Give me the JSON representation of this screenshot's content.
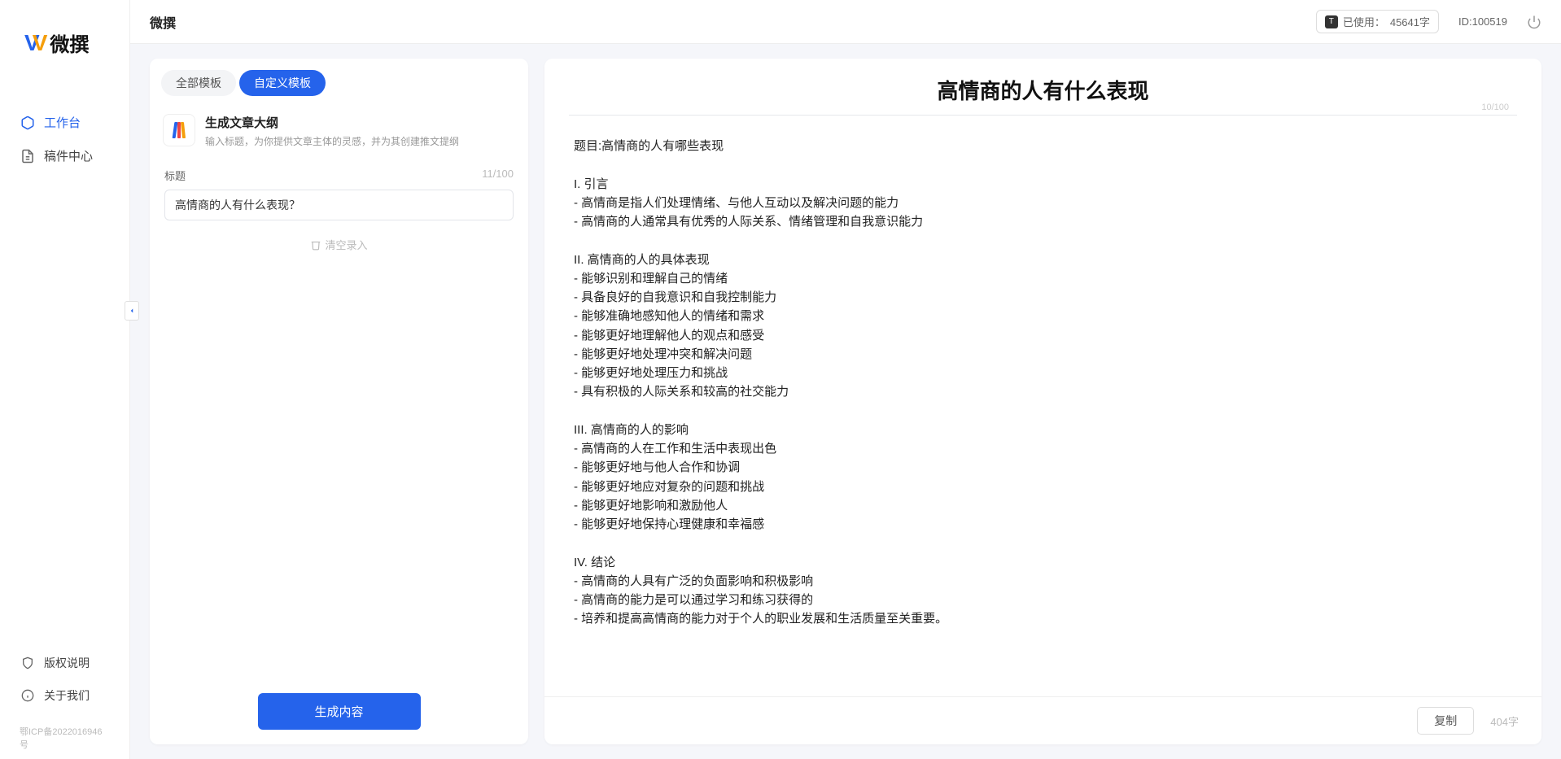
{
  "app": {
    "name": "微撰",
    "header_title": "微撰"
  },
  "topbar": {
    "usage_prefix": "已使用：",
    "usage_value": "45641字",
    "user_id_label": "ID:100519"
  },
  "sidebar": {
    "nav": [
      {
        "label": "工作台",
        "active": true
      },
      {
        "label": "稿件中心",
        "active": false
      }
    ],
    "bottom": [
      {
        "label": "版权说明"
      },
      {
        "label": "关于我们"
      }
    ],
    "icp": "鄂ICP备2022016946号"
  },
  "left_panel": {
    "tabs": [
      {
        "label": "全部模板",
        "active": false
      },
      {
        "label": "自定义模板",
        "active": true
      }
    ],
    "card": {
      "title": "生成文章大纲",
      "desc": "输入标题，为你提供文章主体的灵感，并为其创建推文提纲"
    },
    "form": {
      "label": "标题",
      "counter": "11/100",
      "value": "高情商的人有什么表现？",
      "clear": "清空录入"
    },
    "generate_button": "生成内容"
  },
  "right_panel": {
    "title": "高情商的人有什么表现",
    "title_counter": "10/100",
    "body": "题目:高情商的人有哪些表现\n\nI. 引言\n- 高情商是指人们处理情绪、与他人互动以及解决问题的能力\n- 高情商的人通常具有优秀的人际关系、情绪管理和自我意识能力\n\nII. 高情商的人的具体表现\n- 能够识别和理解自己的情绪\n- 具备良好的自我意识和自我控制能力\n- 能够准确地感知他人的情绪和需求\n- 能够更好地理解他人的观点和感受\n- 能够更好地处理冲突和解决问题\n- 能够更好地处理压力和挑战\n- 具有积极的人际关系和较高的社交能力\n\nIII. 高情商的人的影响\n- 高情商的人在工作和生活中表现出色\n- 能够更好地与他人合作和协调\n- 能够更好地应对复杂的问题和挑战\n- 能够更好地影响和激励他人\n- 能够更好地保持心理健康和幸福感\n\nIV. 结论\n- 高情商的人具有广泛的负面影响和积极影响\n- 高情商的能力是可以通过学习和练习获得的\n- 培养和提高高情商的能力对于个人的职业发展和生活质量至关重要。",
    "copy_button": "复制",
    "word_count": "404字"
  }
}
